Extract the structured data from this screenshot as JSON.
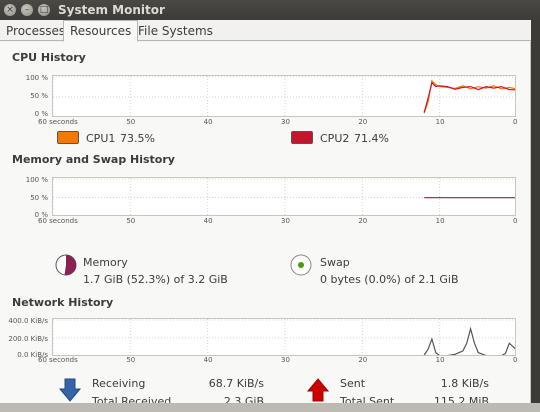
{
  "window": {
    "title": "System Monitor"
  },
  "tabs": [
    {
      "label": "Processes",
      "active": false
    },
    {
      "label": "Resources",
      "active": true
    },
    {
      "label": "File Systems",
      "active": false
    }
  ],
  "x_axis_ticks": [
    "60 seconds",
    "50",
    "40",
    "30",
    "20",
    "10",
    "0"
  ],
  "cpu": {
    "title": "CPU History",
    "y_ticks": [
      "100 %",
      "50 %",
      "0 %"
    ],
    "cpu1": {
      "label": "CPU1",
      "value": "73.5%",
      "color": "#f57900"
    },
    "cpu2": {
      "label": "CPU2",
      "value": "71.4%",
      "color": "#c4152b"
    }
  },
  "memory": {
    "title": "Memory and Swap History",
    "y_ticks": [
      "100 %",
      "50 %",
      "0 %"
    ],
    "mem": {
      "label": "Memory",
      "detail": "1.7 GiB (52.3%) of 3.2 GiB",
      "color": "#8b2252",
      "percent": 52.3
    },
    "swap": {
      "label": "Swap",
      "detail": "0 bytes (0.0%) of 2.1 GiB",
      "color": "#4e9a06",
      "percent": 0.0
    }
  },
  "network": {
    "title": "Network History",
    "y_ticks": [
      "400.0 KiB/s",
      "200.0 KiB/s",
      "0.0 KiB/s"
    ],
    "receiving": {
      "label": "Receiving",
      "value": "68.7 KiB/s",
      "total_label": "Total Received",
      "total": "2.3 GiB",
      "color": "#3465a4"
    },
    "sent": {
      "label": "Sent",
      "value": "1.8 KiB/s",
      "total_label": "Total Sent",
      "total": "115.2 MiB",
      "color": "#cc0000"
    }
  },
  "chart_data": [
    {
      "type": "line",
      "title": "CPU History",
      "ylim": [
        0,
        100
      ],
      "x": [
        12,
        11.5,
        11,
        10.5,
        10,
        9,
        8,
        7,
        6,
        5,
        4,
        3,
        2,
        1,
        0
      ],
      "series": [
        {
          "name": "CPU1",
          "values": [
            10,
            40,
            95,
            85,
            80,
            78,
            75,
            82,
            74,
            80,
            76,
            82,
            74,
            78,
            73.5
          ]
        },
        {
          "name": "CPU2",
          "values": [
            12,
            50,
            90,
            80,
            82,
            80,
            73,
            78,
            80,
            72,
            80,
            76,
            80,
            72,
            71.4
          ]
        }
      ]
    },
    {
      "type": "line",
      "title": "Memory and Swap History",
      "ylim": [
        0,
        100
      ],
      "x": [
        12,
        0
      ],
      "series": [
        {
          "name": "Memory",
          "values": [
            52.3,
            52.3
          ]
        },
        {
          "name": "Swap",
          "values": [
            0,
            0
          ]
        }
      ]
    },
    {
      "type": "line",
      "title": "Network History",
      "ylim": [
        0,
        400
      ],
      "x": [
        12,
        11.5,
        11,
        10.5,
        10,
        9,
        8,
        7,
        6.5,
        6,
        5.5,
        5,
        4,
        3,
        2,
        1.5,
        1,
        0
      ],
      "series": [
        {
          "name": "Receiving",
          "values": [
            10,
            80,
            200,
            40,
            5,
            5,
            20,
            60,
            150,
            320,
            150,
            40,
            5,
            5,
            5,
            30,
            150,
            68.7
          ]
        },
        {
          "name": "Sent",
          "values": [
            2,
            2,
            2,
            2,
            2,
            2,
            2,
            2,
            2,
            2,
            2,
            2,
            2,
            2,
            2,
            2,
            2,
            1.8
          ]
        }
      ]
    }
  ]
}
